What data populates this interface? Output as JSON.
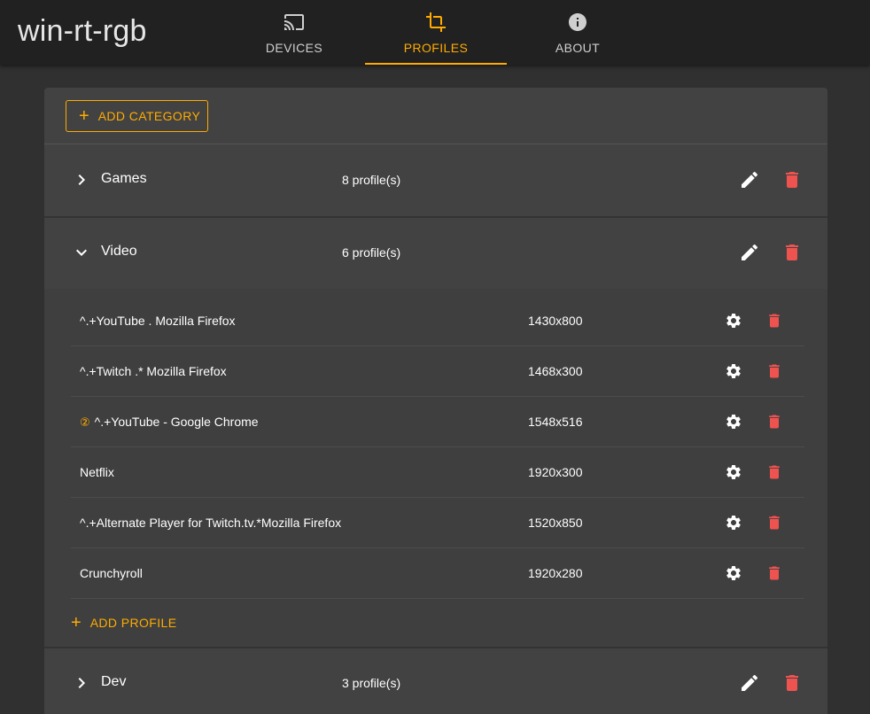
{
  "app": {
    "title": "win-rt-rgb"
  },
  "tabs": [
    {
      "label": "DEVICES",
      "icon": "cast-icon"
    },
    {
      "label": "PROFILES",
      "icon": "crop-icon",
      "active": true
    },
    {
      "label": "ABOUT",
      "icon": "info-icon"
    }
  ],
  "toolbar": {
    "add_category_label": "ADD CATEGORY"
  },
  "categories": [
    {
      "name": "Games",
      "count": "8 profile(s)",
      "expanded": false
    },
    {
      "name": "Video",
      "count": "6 profile(s)",
      "expanded": true
    },
    {
      "name": "Dev",
      "count": "3 profile(s)",
      "expanded": false
    }
  ],
  "profiles": [
    {
      "name": "^.+YouTube . Mozilla Firefox",
      "resolution": "1430x800",
      "badge": ""
    },
    {
      "name": "^.+Twitch .* Mozilla Firefox",
      "resolution": "1468x300",
      "badge": ""
    },
    {
      "name": "^.+YouTube - Google Chrome",
      "resolution": "1548x516",
      "badge": "②"
    },
    {
      "name": "Netflix",
      "resolution": "1920x300",
      "badge": ""
    },
    {
      "name": "^.+Alternate Player for Twitch.tv.*Mozilla Firefox",
      "resolution": "1520x850",
      "badge": ""
    },
    {
      "name": "Crunchyroll",
      "resolution": "1920x280",
      "badge": ""
    }
  ],
  "add_profile_label": "ADD PROFILE",
  "colors": {
    "accent": "#ffab00",
    "danger": "#ef5350",
    "appbar": "#212121",
    "background": "#303030",
    "card": "#424242"
  }
}
